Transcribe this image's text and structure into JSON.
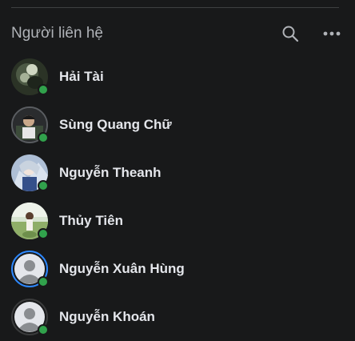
{
  "header": {
    "title": "Người liên hệ",
    "search_icon": "search-icon",
    "more_icon": "more-horizontal-icon"
  },
  "colors": {
    "background": "#18191a",
    "online": "#31a24c",
    "default_avatar_ring": "#2d88ff"
  },
  "contacts": [
    {
      "name": "Hải Tài",
      "online": true,
      "avatar": "photo"
    },
    {
      "name": "Sùng Quang Chữ",
      "online": true,
      "avatar": "photo"
    },
    {
      "name": "Nguyễn Theanh",
      "online": true,
      "avatar": "photo"
    },
    {
      "name": "Thủy Tiên",
      "online": true,
      "avatar": "photo"
    },
    {
      "name": "Nguyễn Xuân Hùng",
      "online": true,
      "avatar": "default-user-icon"
    },
    {
      "name": "Nguyễn Khoán",
      "online": true,
      "avatar": "default-user-icon"
    }
  ]
}
